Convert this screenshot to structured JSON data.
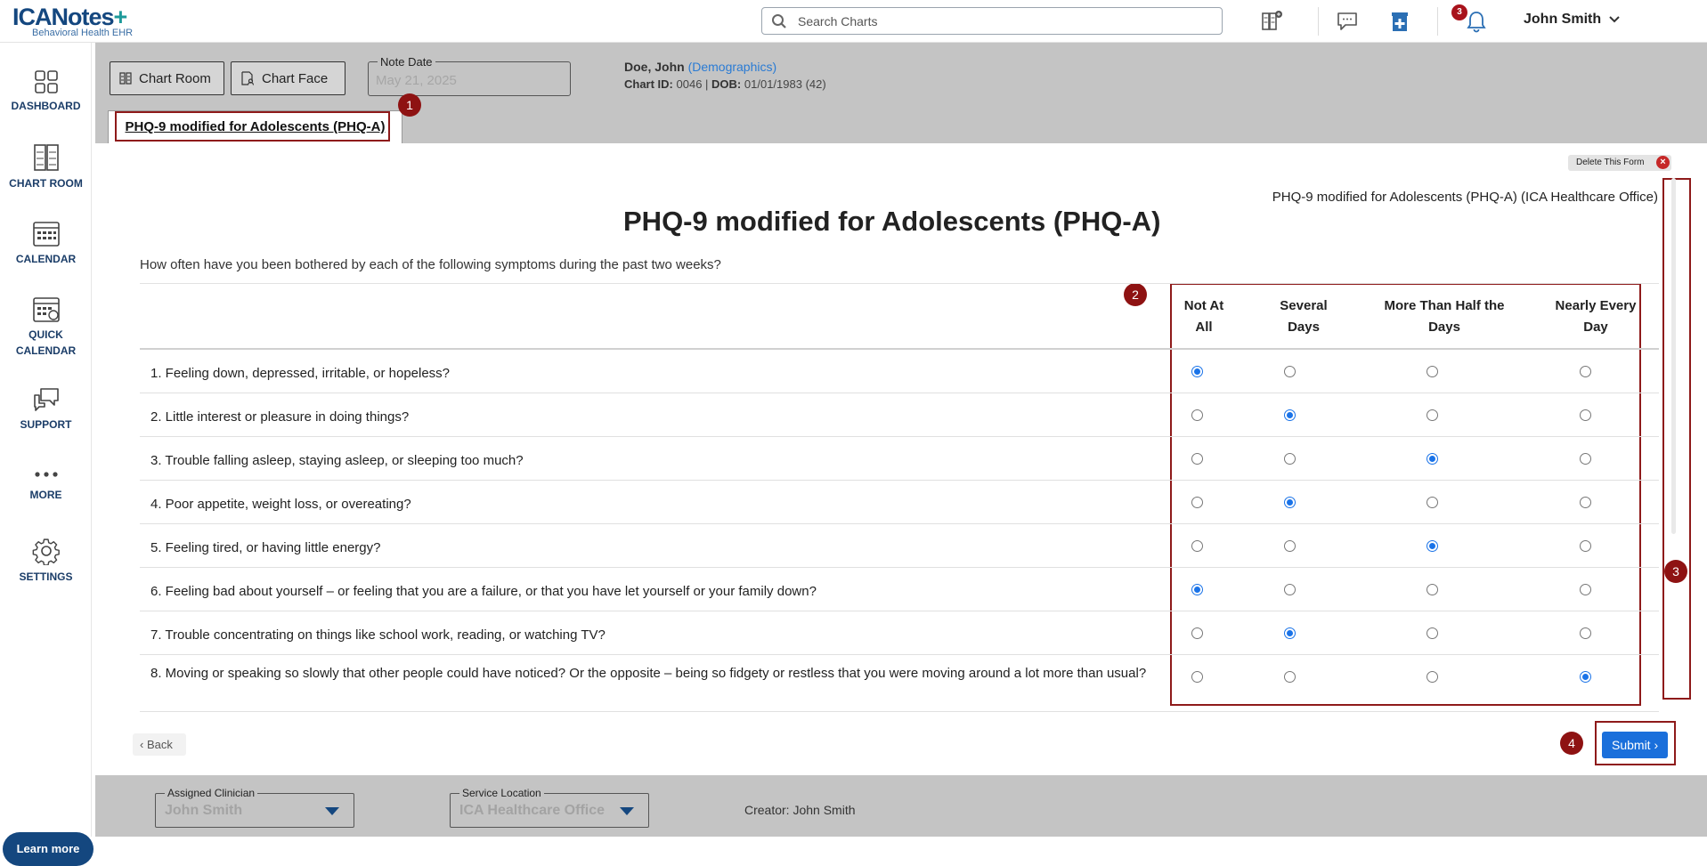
{
  "app": {
    "logo_text": "ICANotes",
    "logo_plus": "+",
    "logo_subtitle": "Behavioral Health EHR"
  },
  "topbar": {
    "search_placeholder": "Search Charts",
    "notification_count": "3",
    "user_name": "John Smith"
  },
  "sidebar": {
    "items": [
      {
        "label": "DASHBOARD",
        "icon": "dashboard-icon"
      },
      {
        "label": "CHART ROOM",
        "icon": "chart-room-icon"
      },
      {
        "label": "CALENDAR",
        "icon": "calendar-icon"
      },
      {
        "label": "QUICK",
        "label2": "CALENDAR",
        "icon": "quick-calendar-icon"
      },
      {
        "label": "SUPPORT",
        "icon": "support-icon"
      },
      {
        "label": "MORE",
        "icon": "more-icon"
      },
      {
        "label": "SETTINGS",
        "icon": "gear-icon"
      }
    ],
    "learn_more": "Learn more"
  },
  "header": {
    "chart_room_btn": "Chart Room",
    "chart_face_btn": "Chart Face",
    "note_date_label": "Note Date",
    "note_date_value": "May 21, 2025",
    "patient_name": "Doe, John",
    "demographics_link": "(Demographics)",
    "chart_id_label": "Chart ID:",
    "chart_id": "0046",
    "dob_label": "DOB:",
    "dob": "01/01/1983 (42)",
    "tab_label": "PHQ-9 modified for Adolescents (PHQ-A)"
  },
  "callouts": [
    "1",
    "2",
    "3",
    "4"
  ],
  "form": {
    "delete_label": "Delete This Form",
    "org_title": "PHQ-9 modified for Adolescents (PHQ-A) (ICA Healthcare Office)",
    "title": "PHQ-9 modified for Adolescents (PHQ-A)",
    "instructions": "How often have you been bothered by each of the following symptoms during the past two weeks?",
    "columns": [
      {
        "line1": "Not At",
        "line2": "All"
      },
      {
        "line1": "Several",
        "line2": "Days"
      },
      {
        "line1": "More Than Half the",
        "line2": "Days"
      },
      {
        "line1": "Nearly Every",
        "line2": "Day"
      }
    ],
    "questions": [
      {
        "text": "1. Feeling down, depressed, irritable, or hopeless?",
        "selected": 0
      },
      {
        "text": "2. Little interest or pleasure in doing things?",
        "selected": 1
      },
      {
        "text": "3. Trouble falling asleep, staying asleep, or sleeping too much?",
        "selected": 2
      },
      {
        "text": "4. Poor appetite, weight loss, or overeating?",
        "selected": 1
      },
      {
        "text": "5. Feeling tired, or having little energy?",
        "selected": 2
      },
      {
        "text": "6. Feeling bad about yourself – or feeling that you are a failure, or that you have let yourself or your family down?",
        "selected": 0
      },
      {
        "text": "7. Trouble concentrating on things like school work, reading, or watching TV?",
        "selected": 1
      },
      {
        "text": "8. Moving or speaking so slowly that other people could have noticed? Or the opposite – being so fidgety or restless that you were moving around a lot more than usual?",
        "selected": 3
      }
    ],
    "back_label": "Back",
    "submit_label": "Submit"
  },
  "footer": {
    "clinician_label": "Assigned Clinician",
    "clinician_value": "John Smith",
    "location_label": "Service Location",
    "location_value": "ICA Healthcare Office",
    "creator": "Creator: John Smith"
  },
  "colors": {
    "brand": "#14477f",
    "accent": "#1a6fdb",
    "header_bg": "#c4c4c4",
    "marker": "#8e1a1a"
  }
}
